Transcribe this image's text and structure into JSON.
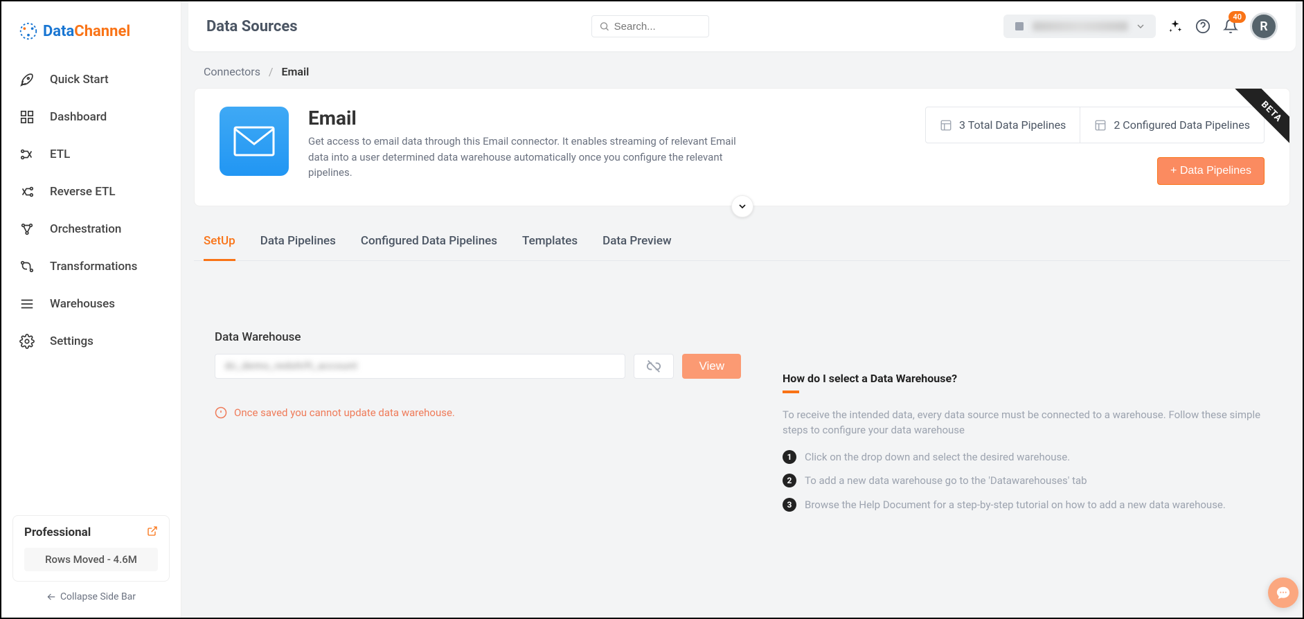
{
  "brand": {
    "part1": "Data",
    "part2": "Channel"
  },
  "sidebar": {
    "items": [
      {
        "label": "Quick Start"
      },
      {
        "label": "Dashboard"
      },
      {
        "label": "ETL"
      },
      {
        "label": "Reverse ETL"
      },
      {
        "label": "Orchestration"
      },
      {
        "label": "Transformations"
      },
      {
        "label": "Warehouses"
      },
      {
        "label": "Settings"
      }
    ],
    "plan": {
      "name": "Professional",
      "stat": "Rows Moved - 4.6M"
    },
    "collapse": "Collapse Side Bar"
  },
  "topbar": {
    "title": "Data Sources",
    "search_placeholder": "Search...",
    "notif_count": "40",
    "avatar_initial": "R"
  },
  "breadcrumb": {
    "parent": "Connectors",
    "current": "Email"
  },
  "hero": {
    "title": "Email",
    "desc": "Get access to email data through this Email connector. It enables streaming of relevant Email data into a user determined data warehouse automatically once you configure the relevant pipelines.",
    "stat1": "3 Total Data Pipelines",
    "stat2": "2 Configured Data Pipelines",
    "add_btn": "+ Data Pipelines",
    "ribbon": "BETA"
  },
  "tabs": [
    {
      "label": "SetUp"
    },
    {
      "label": "Data Pipelines"
    },
    {
      "label": "Configured Data Pipelines"
    },
    {
      "label": "Templates"
    },
    {
      "label": "Data Preview"
    }
  ],
  "form": {
    "label": "Data Warehouse",
    "selected_value": "dc_demo_redshift_account",
    "view_btn": "View",
    "warning": "Once saved you cannot update data warehouse."
  },
  "help": {
    "title": "How do I select a Data Warehouse?",
    "desc": "To receive the intended data, every data source must be connected to a warehouse. Follow these simple steps to configure your data warehouse",
    "steps": [
      "Click on the drop down and select the desired warehouse.",
      "To add a new data warehouse go to the 'Datawarehouses' tab",
      "Browse the Help Document for a step-by-step tutorial on how to add a new data warehouse."
    ]
  }
}
